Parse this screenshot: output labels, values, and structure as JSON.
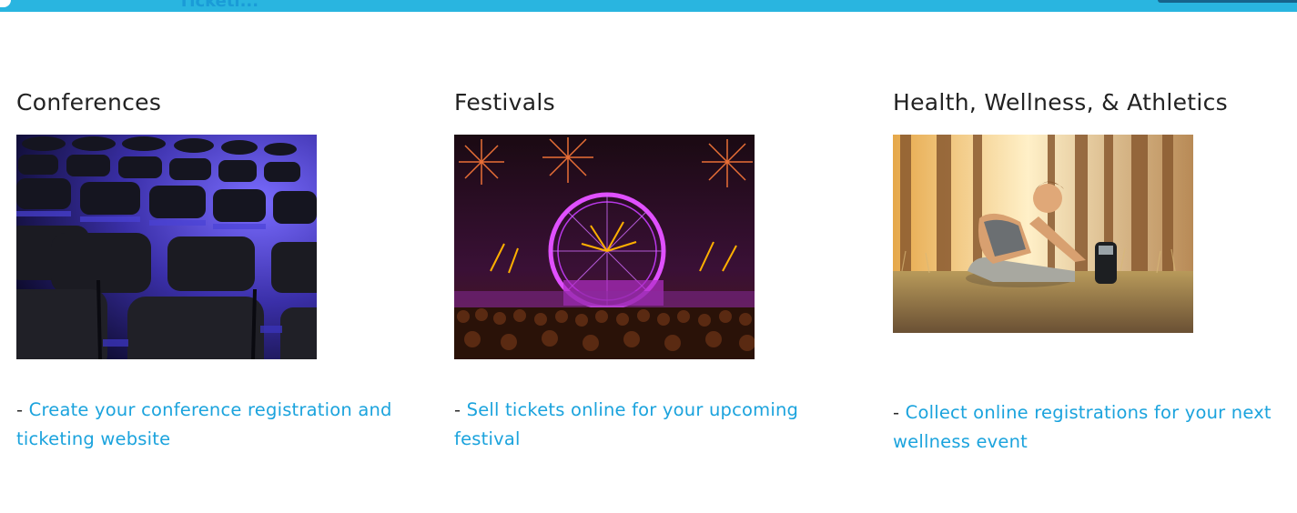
{
  "top_nav": {
    "partial_link": "Ticketi..."
  },
  "colors": {
    "accent": "#29b5e0",
    "link": "#1ba3dd",
    "heading": "#222222"
  },
  "categories": [
    {
      "title": "Conferences",
      "image": "conference-chairs-photo",
      "dash": "- ",
      "link_text": "Create your conference registration and ticketing website"
    },
    {
      "title": "Festivals",
      "image": "festival-fireworks-ferris-wheel-photo",
      "dash": "- ",
      "link_text": "Sell tickets online for your upcoming festival"
    },
    {
      "title": "Health, Wellness, & Athletics",
      "image": "woman-stretching-in-forest-photo",
      "dash": "- ",
      "link_text": "Collect online registrations for your next wellness event"
    }
  ]
}
